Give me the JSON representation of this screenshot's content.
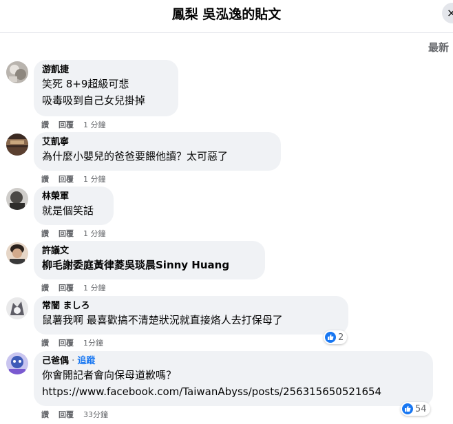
{
  "header": {
    "title": "鳳梨 吳泓逸的貼文",
    "close_label": "×"
  },
  "sort_label": "最新",
  "actions": {
    "like": "讚",
    "reply": "回覆"
  },
  "comments": [
    {
      "author": "游凱捷",
      "lines": [
        "笑死 8+9超級可悲",
        "吸毒吸到自己女兒掛掉"
      ],
      "time": "1 分鐘"
    },
    {
      "author": "艾凱寧",
      "lines": [
        "為什麼小嬰兒的爸爸要餵他讀？太可惡了"
      ],
      "time": "1 分鐘"
    },
    {
      "author": "林榮軍",
      "lines": [
        "就是個笑話"
      ],
      "time": "1 分鐘"
    },
    {
      "author": "許議文",
      "lines": [
        "柳毛謝委庭黃律菱吳琰晨Sinny Huang"
      ],
      "time": "1 分鐘"
    },
    {
      "author": "常闇 ましろ",
      "lines": [
        "鼠薯我啊 最喜歡搞不清楚狀況就直接烙人去打保母了"
      ],
      "time": "1分鐘",
      "reactions": "2"
    },
    {
      "author": "己爸偶",
      "follow": "追蹤",
      "lines": [
        "你會開記者會向保母道歉嗎？",
        "https://www.facebook.com/TaiwanAbyss/posts/256315650521654"
      ],
      "time": "33分鐘",
      "reactions": "54"
    }
  ],
  "colors": {
    "bubble": "#f0f2f5",
    "secondary_text": "#65676b",
    "accent": "#1877f2"
  }
}
